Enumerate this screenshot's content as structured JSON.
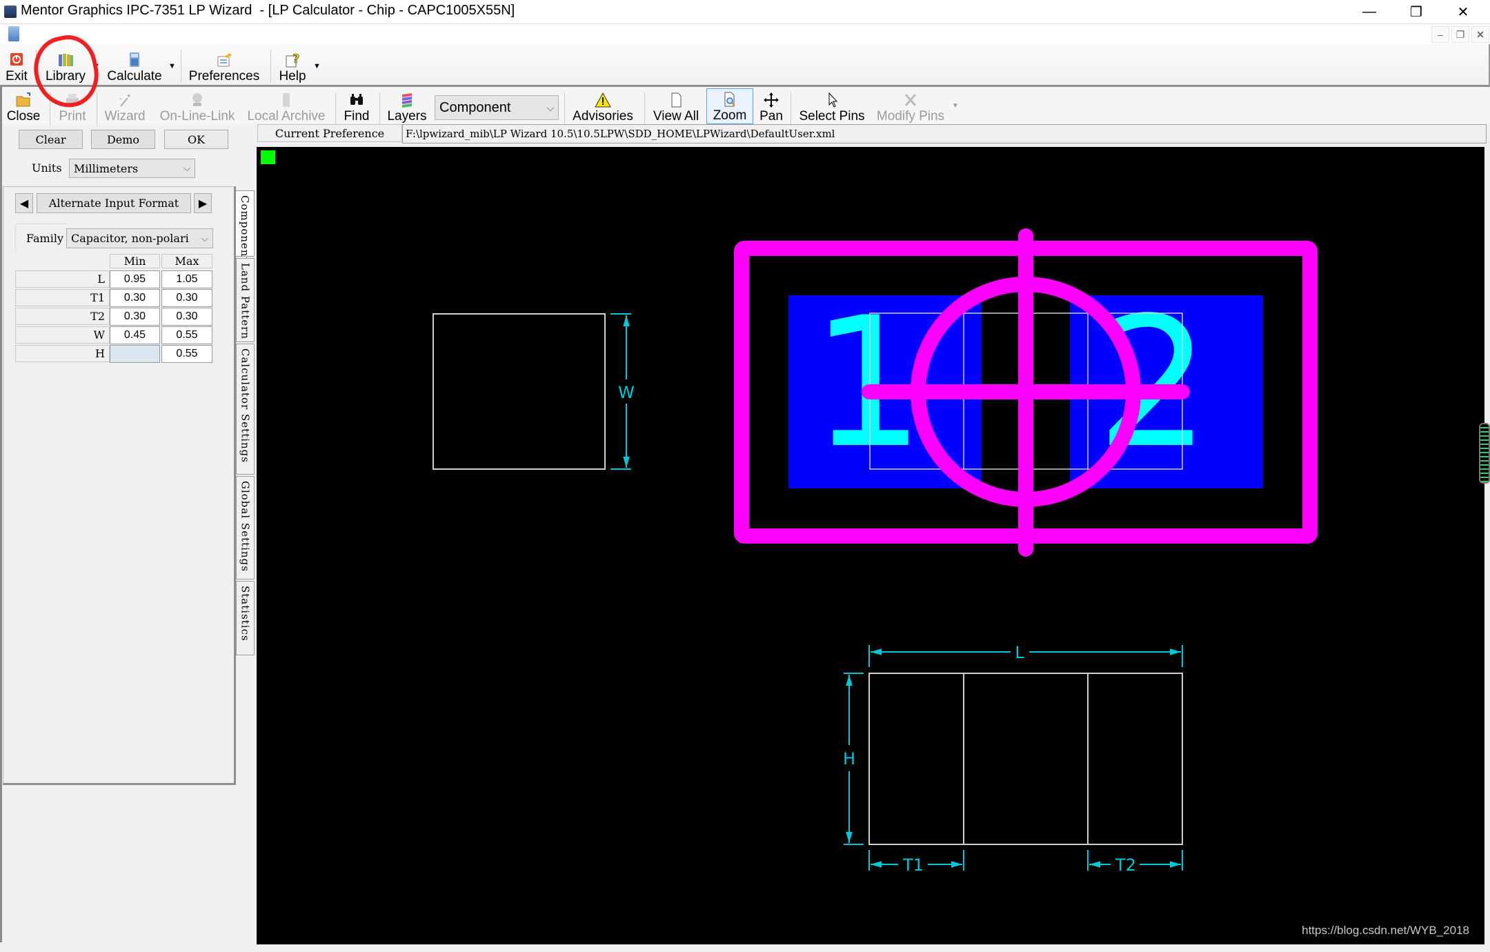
{
  "window": {
    "title": "Mentor Graphics IPC-7351 LP Wizard  - [LP Calculator - Chip - CAPC1005X55N]",
    "min_glyph": "—",
    "max_glyph": "❐",
    "close_glyph": "✕",
    "mdi_min_glyph": "–",
    "mdi_restore_glyph": "❐",
    "mdi_close_glyph": "✕"
  },
  "toolbar1": {
    "items": [
      {
        "label": "Exit",
        "icon": "exit-icon"
      },
      {
        "label": "Library",
        "icon": "library-icon"
      },
      {
        "label": "Calculate",
        "icon": "calculator-icon"
      },
      {
        "label": "Preferences",
        "icon": "preferences-icon"
      },
      {
        "label": "Help",
        "icon": "help-icon"
      }
    ],
    "dropdown_glyph": "▼"
  },
  "toolbar2": {
    "items": [
      {
        "label": "Close",
        "icon": "folder-icon",
        "enabled": true
      },
      {
        "label": "Print",
        "icon": "printer-icon",
        "enabled": false
      },
      {
        "label": "Wizard",
        "icon": "wand-icon",
        "enabled": false
      },
      {
        "label": "On-Line-Link",
        "icon": "globe-link-icon",
        "enabled": false
      },
      {
        "label": "Local Archive",
        "icon": "archive-icon",
        "enabled": false
      },
      {
        "label": "Find",
        "icon": "binoculars-icon",
        "enabled": true
      },
      {
        "label": "Layers",
        "icon": "layers-icon",
        "enabled": true
      },
      {
        "label": "Advisories",
        "icon": "warning-icon",
        "enabled": true
      },
      {
        "label": "View All",
        "icon": "page-icon",
        "enabled": true
      },
      {
        "label": "Zoom",
        "icon": "zoom-icon",
        "enabled": true,
        "active": true
      },
      {
        "label": "Pan",
        "icon": "pan-icon",
        "enabled": true
      },
      {
        "label": "Select Pins",
        "icon": "cursor-icon",
        "enabled": true
      },
      {
        "label": "Modify Pins",
        "icon": "tools-icon",
        "enabled": false
      }
    ],
    "layer_select": {
      "value": "Component"
    }
  },
  "panel": {
    "buttons": {
      "clear": "Clear",
      "demo": "Demo",
      "ok": "OK"
    },
    "units": {
      "label": "Units",
      "value": "Millimeters"
    },
    "alt_format": {
      "label": "Alternate Input Format",
      "prev": "◀",
      "next": "▶"
    },
    "family": {
      "label": "Family",
      "value": "Capacitor, non-polari"
    },
    "table": {
      "headers": [
        "Min",
        "Max"
      ],
      "rows": [
        {
          "label": "L",
          "min": "0.95",
          "max": "1.05"
        },
        {
          "label": "T1",
          "min": "0.30",
          "max": "0.30"
        },
        {
          "label": "T2",
          "min": "0.30",
          "max": "0.30"
        },
        {
          "label": "W",
          "min": "0.45",
          "max": "0.55"
        },
        {
          "label": "H",
          "min": "",
          "max": "0.55"
        }
      ]
    },
    "tabs": [
      "Component",
      "Land Pattern",
      "Calculator Settings",
      "Global Settings",
      "Statistics"
    ],
    "active_tab": "Component"
  },
  "preference": {
    "label": "Current Preference",
    "path": "F:\\lpwizard_mib\\LP Wizard 10.5\\10.5LPW\\SDD_HOME\\LPWizard\\DefaultUser.xml"
  },
  "canvas": {
    "colors": {
      "background": "#000000",
      "silkscreen": "#ff00ff",
      "pad": "#0000ff",
      "pin_number": "#00ffff",
      "dimension": "#00c8d8",
      "body_outline": "#d0d0d0",
      "origin_marker": "#00ff00"
    },
    "pin_numbers": [
      "1",
      "2"
    ],
    "dimension_labels": {
      "w": "W",
      "l": "L",
      "h": "H",
      "t1": "T1",
      "t2": "T2"
    }
  },
  "watermark": "https://blog.csdn.net/WYB_2018"
}
